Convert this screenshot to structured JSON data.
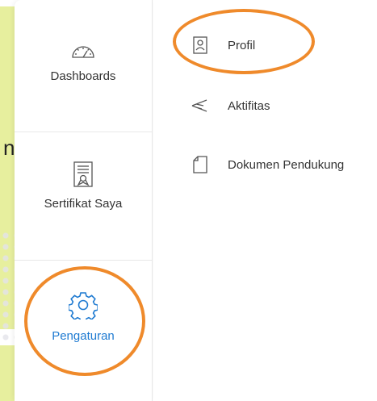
{
  "backdrop": {
    "letter": "n"
  },
  "main_nav": {
    "items": [
      {
        "label": "Dashboards",
        "icon": "gauge-icon"
      },
      {
        "label": "Sertifikat Saya",
        "icon": "certificate-icon"
      },
      {
        "label": "Pengaturan",
        "icon": "gear-icon",
        "active": true,
        "color": "#1e7ad1"
      }
    ]
  },
  "sub_menu": {
    "items": [
      {
        "label": "Profil",
        "icon": "profile-card-icon"
      },
      {
        "label": "Aktifitas",
        "icon": "feather-icon"
      },
      {
        "label": "Dokumen Pendukung",
        "icon": "document-icon"
      }
    ]
  },
  "highlight_color": "#ef8a2b"
}
